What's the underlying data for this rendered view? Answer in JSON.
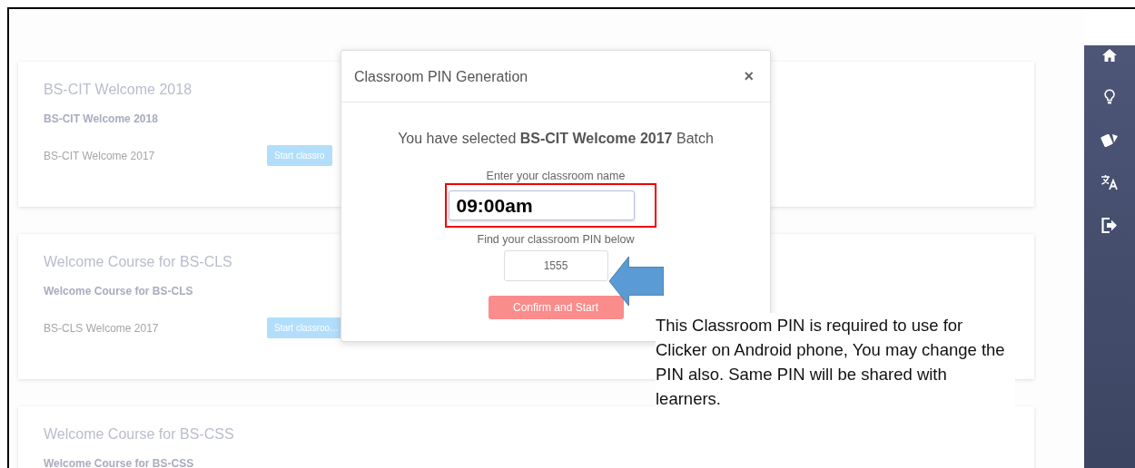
{
  "cards": [
    {
      "title": "BS-CIT Welcome 2018",
      "subtitle": "BS-CIT Welcome 2018",
      "batch": "BS-CIT Welcome 2017",
      "button": "Start classro"
    },
    {
      "title": "Welcome Course for BS-CLS",
      "subtitle": "Welcome Course for BS-CLS",
      "batch": "BS-CLS Welcome 2017",
      "button": "Start classroo…"
    },
    {
      "title": "Welcome Course for BS-CSS",
      "subtitle": "Welcome Course for BS-CSS"
    }
  ],
  "sidebar": {
    "items": [
      {
        "kind": "home"
      },
      {
        "kind": "bulb"
      },
      {
        "kind": "cards"
      },
      {
        "kind": "translate"
      },
      {
        "kind": "logout"
      }
    ]
  },
  "modal": {
    "title": "Classroom PIN Generation",
    "close": "×",
    "message": "You have selected **BS-CIT Welcome 2017** Batch",
    "name_label": "Enter your classroom name",
    "name_value": "09:00am",
    "pin_label": "Find your classroom PIN below",
    "pin_value": "1555",
    "button": "Confirm and Start"
  },
  "annotation": {
    "text": "This Classroom PIN is required to use for Clicker on Android phone, You may change the PIN also. Same PIN will be shared with learners."
  }
}
